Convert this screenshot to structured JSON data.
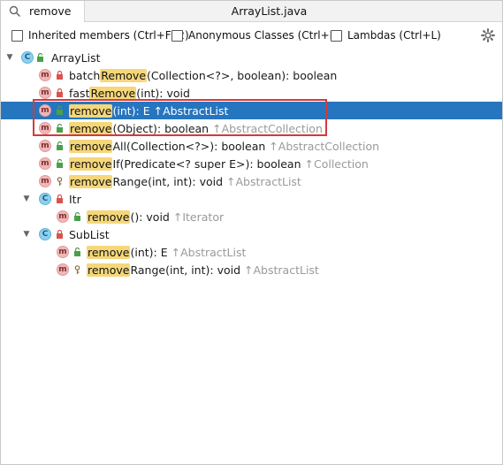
{
  "header": {
    "search_value": "remove",
    "file_title": "ArrayList.java"
  },
  "options": {
    "inherited": "Inherited members (Ctrl+F12)",
    "anonymous": "Anonymous Classes (Ctrl+I)",
    "lambdas": "Lambdas (Ctrl+L)"
  },
  "tree": {
    "root": "ArrayList",
    "items": [
      {
        "pre": "batch",
        "hl": "Remove",
        "post": "(Collection<?>, boolean): boolean",
        "inherit": ""
      },
      {
        "pre": "fast",
        "hl": "Remove",
        "post": "(int): void",
        "inherit": ""
      },
      {
        "pre": "",
        "hl": "remove",
        "post": "(int): E",
        "inherit": "↑AbstractList"
      },
      {
        "pre": "",
        "hl": "remove",
        "post": "(Object): boolean",
        "inherit": "↑AbstractCollection"
      },
      {
        "pre": "",
        "hl": "remove",
        "post": "All(Collection<?>): boolean",
        "inherit": "↑AbstractCollection"
      },
      {
        "pre": "",
        "hl": "remove",
        "post": "If(Predicate<? super E>): boolean",
        "inherit": "↑Collection"
      },
      {
        "pre": "",
        "hl": "remove",
        "post": "Range(int, int): void",
        "inherit": "↑AbstractList"
      }
    ],
    "itr": {
      "label": "Itr",
      "items": [
        {
          "pre": "",
          "hl": "remove",
          "post": "(): void",
          "inherit": "↑Iterator"
        }
      ]
    },
    "sublist": {
      "label": "SubList",
      "items": [
        {
          "pre": "",
          "hl": "remove",
          "post": "(int): E",
          "inherit": "↑AbstractList"
        },
        {
          "pre": "",
          "hl": "remove",
          "post": "Range(int, int): void",
          "inherit": "↑AbstractList"
        }
      ]
    }
  },
  "badges": {
    "method": "m",
    "class": "C"
  },
  "colors": {
    "selection": "#2675bf",
    "highlight": "#f5d77a",
    "annotation": "#d33a3a"
  }
}
